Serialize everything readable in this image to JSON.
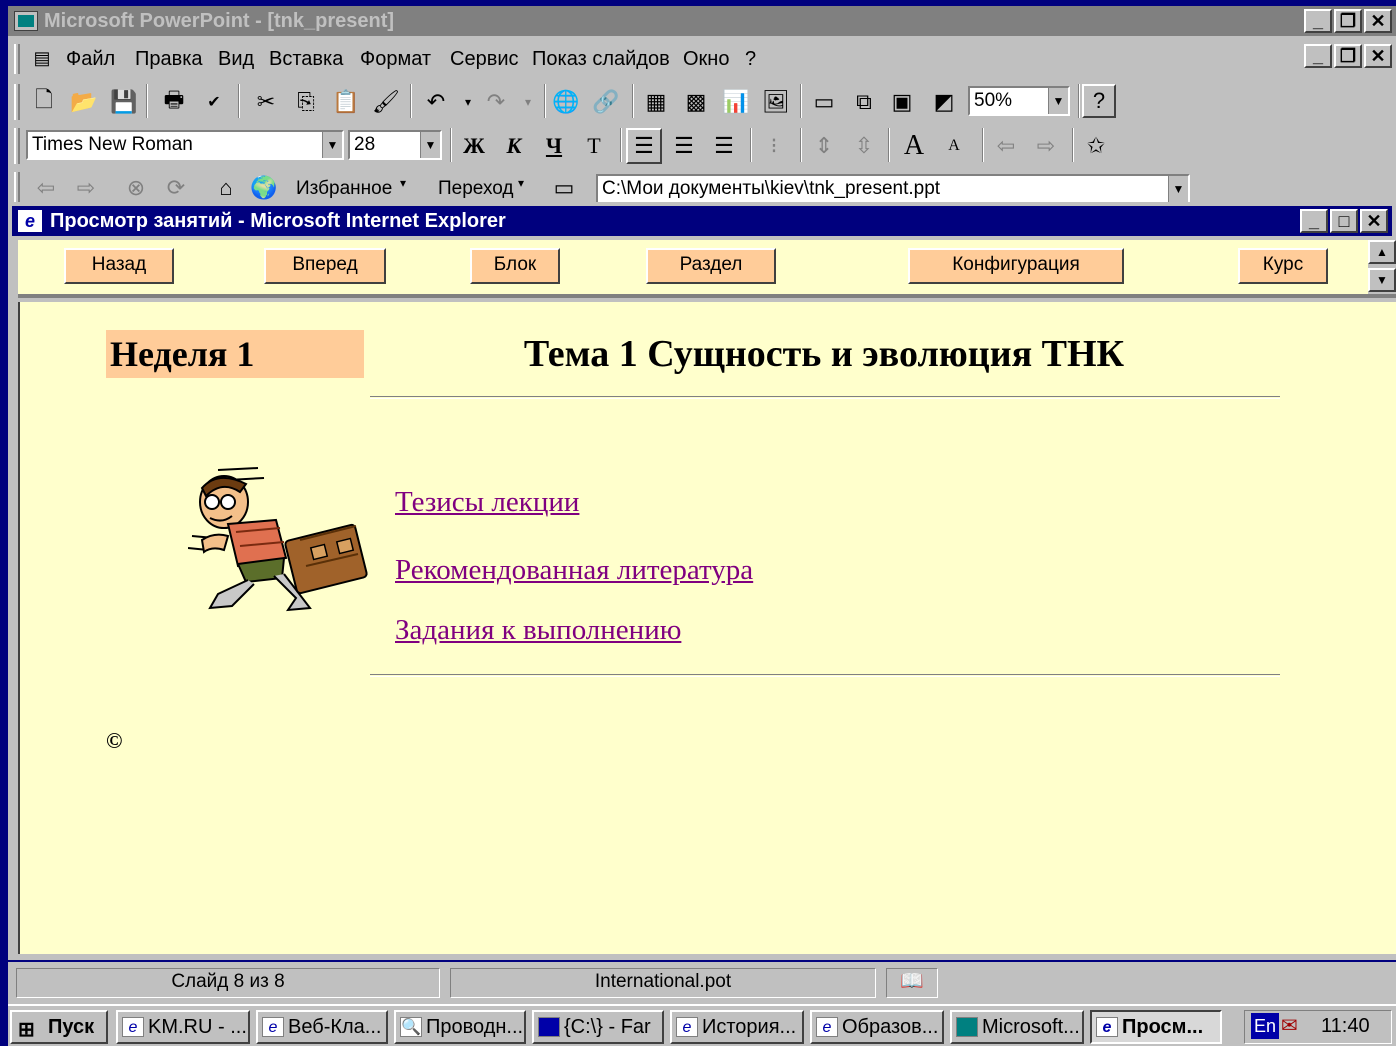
{
  "powerpoint": {
    "title": "Microsoft PowerPoint - [tnk_present]",
    "menu": [
      "Файл",
      "Правка",
      "Вид",
      "Вставка",
      "Формат",
      "Сервис",
      "Показ слайдов",
      "Окно",
      "?"
    ],
    "zoom": "50%",
    "font_name": "Times New Roman",
    "font_size": "28",
    "web_toolbar": {
      "favorites": "Избранное",
      "goto": "Переход",
      "address": "C:\\Мои документы\\kiev\\tnk_present.ppt"
    },
    "status": {
      "slide": "Слайд 8 из 8",
      "template": "International.pot"
    }
  },
  "ie": {
    "title": "Просмотр занятий - Microsoft Internet Explorer",
    "nav": [
      "Назад",
      "Вперед",
      "Блок",
      "Раздел",
      "Конфигурация",
      "Курс"
    ],
    "week": "Неделя 1",
    "topic": "Тема 1 Сущность и эволюция ТНК",
    "links": [
      "Тезисы лекции",
      "Рекомендованная литература",
      "Задания к выполнению"
    ],
    "copyright": "©"
  },
  "taskbar": {
    "start": "Пуск",
    "tasks": [
      "KM.RU - ...",
      "Веб-Кла...",
      "Проводн...",
      "{C:\\} - Far",
      "История...",
      "Образов...",
      "Microsoft...",
      "Просм..."
    ],
    "lang": "En",
    "clock": "11:40"
  },
  "colors": {
    "desktop": "#00007e",
    "page_bg": "#ffffcc",
    "nav_button": "#ffcc99",
    "link": "#800080"
  }
}
